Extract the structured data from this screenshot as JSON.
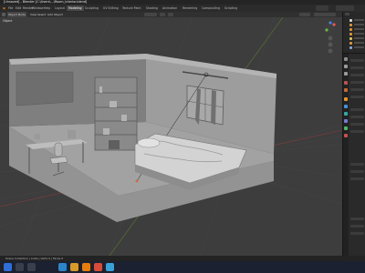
{
  "window": {
    "title": "[Unsaved] - Blender [C:\\Users\\...\\Room_Interior.blend]"
  },
  "menu": {
    "items": [
      "File",
      "Edit",
      "Render",
      "Window",
      "Help"
    ],
    "workspaces": [
      "Layout",
      "Modeling",
      "Sculpting",
      "UV Editing",
      "Texture Paint",
      "Shading",
      "Animation",
      "Rendering",
      "Compositing",
      "Scripting"
    ],
    "active_workspace": "Modeling"
  },
  "header": {
    "object_mode": "Object Mode",
    "view": "View",
    "select": "Select",
    "add": "Add",
    "object": "Object"
  },
  "viewport": {
    "label": "Object",
    "colors": {
      "background": "#3d3d3d",
      "grid": "#4a4a4a"
    }
  },
  "status": {
    "text": "Scene Collection | Cube | Verts 0 | Faces 0"
  },
  "taskbar": {
    "icons": [
      "start-icon",
      "search-icon",
      "file-explorer-icon",
      "browser-icon",
      "store-icon",
      "blender-icon",
      "chrome-icon",
      "mail-icon"
    ]
  }
}
